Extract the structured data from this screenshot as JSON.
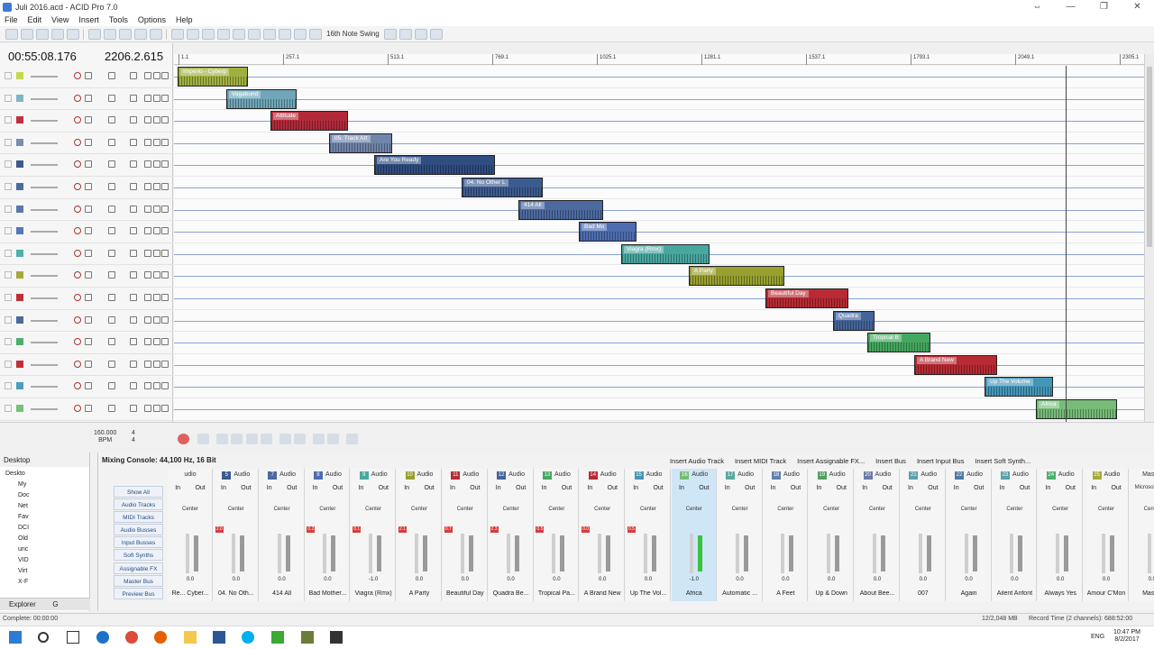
{
  "window": {
    "title": "Juli 2016.acd - ACID Pro 7.0",
    "controls": [
      "⇔",
      "—",
      "❐",
      "✕"
    ]
  },
  "menu": [
    "File",
    "Edit",
    "View",
    "Insert",
    "Tools",
    "Options",
    "Help"
  ],
  "toolbar": {
    "swing_label": "16th Note Swing"
  },
  "position": {
    "time": "00:55:08.176",
    "beats": "2206.2.615"
  },
  "ruler_marks": [
    "1.1",
    "257.1",
    "513.1",
    "769.1",
    "1025.1",
    "1281.1",
    "1537.1",
    "1793.1",
    "2049.1",
    "2305.1"
  ],
  "tracks": [
    {
      "color": "#c5d74e"
    },
    {
      "color": "#7fb6c7"
    },
    {
      "color": "#c03040"
    },
    {
      "color": "#7a8cb0"
    },
    {
      "color": "#3d5a8a"
    },
    {
      "color": "#4b6aa0"
    },
    {
      "color": "#5a78aa"
    },
    {
      "color": "#5577bb"
    },
    {
      "color": "#4fb0a8"
    },
    {
      "color": "#a6aa3c"
    },
    {
      "color": "#c0303a"
    },
    {
      "color": "#4a6b9a"
    },
    {
      "color": "#4fae6a"
    },
    {
      "color": "#c03038"
    },
    {
      "color": "#4a9ec0"
    },
    {
      "color": "#78c07a"
    }
  ],
  "clips": [
    {
      "label": "Imperio - Cyberp",
      "color": "#a0b040"
    },
    {
      "label": "Vagabund",
      "color": "#6fa6b8"
    },
    {
      "label": "Attitude",
      "color": "#b22a3a"
    },
    {
      "label": "05. Track Art",
      "color": "#7085aa"
    },
    {
      "label": "Are You Ready",
      "color": "#304d80"
    },
    {
      "label": "04. No Other L",
      "color": "#3c5b90"
    },
    {
      "label": "414 All",
      "color": "#4c6aa0"
    },
    {
      "label": "Bad Mo",
      "color": "#4e6db0"
    },
    {
      "label": "Viagra (Rmx)",
      "color": "#48a8a0"
    },
    {
      "label": "A Party",
      "color": "#98a030"
    },
    {
      "label": "Beautiful Day",
      "color": "#b82a34"
    },
    {
      "label": "Quadra",
      "color": "#45659a"
    },
    {
      "label": "Tropical B",
      "color": "#45a860"
    },
    {
      "label": "A Brand New",
      "color": "#b82a34"
    },
    {
      "label": "Up The Volume",
      "color": "#4496b8"
    },
    {
      "label": "Africa",
      "color": "#76bc78"
    }
  ],
  "transport": {
    "tempo": "160.000",
    "tempo_unit": "BPM",
    "meter_top": "4",
    "meter_bottom": "4"
  },
  "explorer": {
    "title": "Desktop",
    "tree": [
      "Deskto",
      "My",
      "Doc",
      "Net",
      "Fav",
      "DCI",
      "Old",
      "unc",
      "VID",
      "Virt",
      "X-F"
    ],
    "tabs": [
      "Explorer",
      "G"
    ]
  },
  "mixer": {
    "title": "Mixing Console: 44,100 Hz, 16 Bit",
    "actions": [
      "Insert Audio Track",
      "Insert MIDI Track",
      "Insert Assignable FX...",
      "Insert Bus",
      "Insert Input Bus",
      "Insert Soft Synth..."
    ],
    "filters": [
      "Show All",
      "Audio Tracks",
      "MIDI Tracks",
      "Audio Busses",
      "Input Busses",
      "Soft Synths",
      "Assignable FX",
      "Master Bus",
      "Preview Bus"
    ],
    "strips": [
      {
        "num": "",
        "type": "udio",
        "name": "Re... Cyber...",
        "db": "0.0",
        "peak": "",
        "color": "#999999"
      },
      {
        "num": "5",
        "type": "Audio",
        "name": "04. No Oth...",
        "db": "0.0",
        "peak": "2.0",
        "color": "#3c5b90"
      },
      {
        "num": "7",
        "type": "Audio",
        "name": "414 All",
        "db": "0.0",
        "peak": "",
        "color": "#4c6aa0"
      },
      {
        "num": "8",
        "type": "Audio",
        "name": "Bad Mother...",
        "db": "0.0",
        "peak": "0.2",
        "color": "#4e6db0"
      },
      {
        "num": "9",
        "type": "Audio",
        "name": "Viagra (Rmx)",
        "db": "-1.0",
        "peak": "0.1",
        "color": "#48a8a0"
      },
      {
        "num": "10",
        "type": "Audio",
        "name": "A Party",
        "db": "0.0",
        "peak": "2.1",
        "color": "#98a030"
      },
      {
        "num": "11",
        "type": "Audio",
        "name": "Beautiful Day",
        "db": "0.0",
        "peak": "0.7",
        "color": "#b82a34"
      },
      {
        "num": "12",
        "type": "Audio",
        "name": "Quadra Be...",
        "db": "0.0",
        "peak": "2.3",
        "color": "#45659a"
      },
      {
        "num": "13",
        "type": "Audio",
        "name": "Tropical Pa...",
        "db": "0.0",
        "peak": "0.5",
        "color": "#45a860"
      },
      {
        "num": "14",
        "type": "Audio",
        "name": "A Brand New",
        "db": "0.0",
        "peak": "0.0",
        "color": "#b82a34"
      },
      {
        "num": "15",
        "type": "Audio",
        "name": "Up The Vol...",
        "db": "0.0",
        "peak": "0.5",
        "color": "#4496b8"
      },
      {
        "num": "16",
        "type": "Audio",
        "name": "Africa",
        "db": "-1.0",
        "peak": "",
        "color": "#76bc78"
      },
      {
        "num": "17",
        "type": "Audio",
        "name": "Automatic ...",
        "db": "0.0",
        "peak": "",
        "color": "#5aa9a0"
      },
      {
        "num": "18",
        "type": "Audio",
        "name": "A Feet",
        "db": "0.0",
        "peak": "",
        "color": "#6080b0"
      },
      {
        "num": "19",
        "type": "Audio",
        "name": "Up & Down",
        "db": "0.0",
        "peak": "",
        "color": "#55a060"
      },
      {
        "num": "20",
        "type": "Audio",
        "name": "About Bee...",
        "db": "0.0",
        "peak": "",
        "color": "#6a7aa8"
      },
      {
        "num": "21",
        "type": "Audio",
        "name": "007",
        "db": "0.0",
        "peak": "",
        "color": "#59a0b0"
      },
      {
        "num": "22",
        "type": "Audio",
        "name": "Again",
        "db": "0.0",
        "peak": "",
        "color": "#4f78a8"
      },
      {
        "num": "23",
        "type": "Audio",
        "name": "Ailent Anfont",
        "db": "0.0",
        "peak": "",
        "color": "#5aa0a8"
      },
      {
        "num": "24",
        "type": "Audio",
        "name": "Always Yes",
        "db": "0.0",
        "peak": "",
        "color": "#4fae6a"
      },
      {
        "num": "25",
        "type": "Audio",
        "name": "Amour C'Mon",
        "db": "0.0",
        "peak": "",
        "color": "#a6aa3c"
      },
      {
        "num": "",
        "type": "Master",
        "name": "Master",
        "db": "0.0",
        "peak": "",
        "color": "#888888"
      }
    ],
    "master_out": "Microsoft So..."
  },
  "status": {
    "left": "Complete: 00:00:00",
    "memory": "12/2,048 MB",
    "record_time": "Record Time (2 channels): 688:52:00"
  },
  "taskbar": {
    "lang": "ENG",
    "time": "10:47 PM",
    "date": "8/2/2017"
  }
}
